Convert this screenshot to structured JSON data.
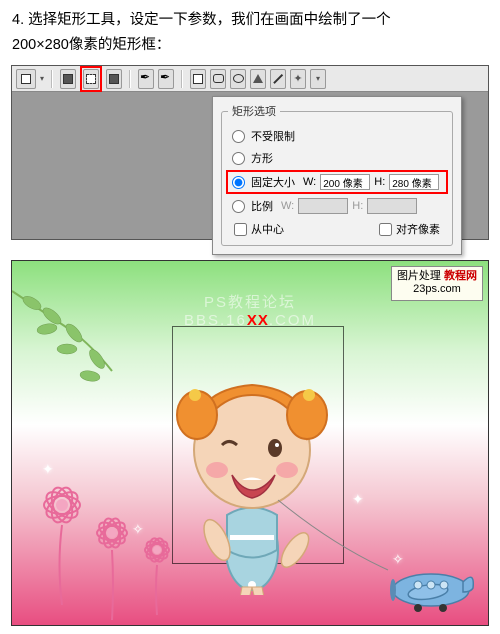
{
  "step": {
    "number": "4.",
    "text_line1": "选择矩形工具，设定一下参数，我们在画面中绘制了一个",
    "text_line2": "200×280像素的矩形框："
  },
  "panel": {
    "title": "矩形选项",
    "opt_unconstrained": "不受限制",
    "opt_square": "方形",
    "opt_fixed": "固定大小",
    "opt_ratio": "比例",
    "w_label": "W:",
    "h_label": "H:",
    "w_value": "200 像素",
    "h_value": "280 像素",
    "from_center": "从中心",
    "snap_pixels": "对齐像素"
  },
  "watermark": {
    "line1": "PS教程论坛",
    "line2_prefix": "BBS.16",
    "line2_red": "XX",
    "line2_suffix": ".COM",
    "badge_line1": "图片处理",
    "badge_line2": "23ps.com",
    "badge_red": "教程网"
  },
  "toolbar_icons": [
    "layer-mode-icon",
    "divider",
    "rect-new-icon",
    "rect-path-icon",
    "rect-fill-icon",
    "divider",
    "pen-icon",
    "freeform-pen-icon",
    "divider",
    "rect-tool-icon",
    "rounded-rect-icon",
    "ellipse-icon",
    "polygon-icon",
    "line-icon",
    "custom-shape-icon",
    "dropdown-icon"
  ],
  "chart_data": null
}
